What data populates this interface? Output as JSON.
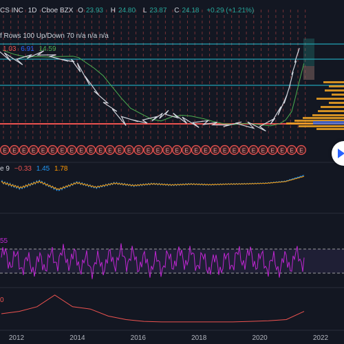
{
  "header": {
    "symbol_partial": "CS INC",
    "interval": "1D",
    "exchange": "Cboe BZX",
    "open_label": "O",
    "open": "23.93",
    "high_label": "H",
    "high": "24.80",
    "low_label": "L",
    "low": "23.87",
    "close_label": "C",
    "close": "24.18",
    "change": "+0.29 (+1.21%)"
  },
  "volume_profile_legend": "f Rows 100 Up/Down 70  n/a  n/a  n/a",
  "ma_legend": {
    "v1": "1.03",
    "v2": "6.91",
    "v3": "14.59"
  },
  "macd_legend": {
    "label": "e 9",
    "v1": "−0.33",
    "v2": "1.45",
    "v3": "1.78"
  },
  "rsi_legend": "55",
  "bottom_legend": "0",
  "scroll_button": {
    "icon": "chevron-right-icon"
  },
  "earnings_marker": {
    "letter": "E",
    "count": 32
  },
  "colors": {
    "background": "#131722",
    "up": "#26a69a",
    "down": "#ef5350",
    "ma_long": "#4caf50",
    "volume_profile": "#f5a623",
    "rsi": "#9c27b0",
    "cyan_line": "#26c6da"
  },
  "chart_data": {
    "type": "line",
    "x_axis_ticks": [
      "2012",
      "2014",
      "2016",
      "2018",
      "2020",
      "2022"
    ],
    "price_series": {
      "name": "Close",
      "x": [
        2011.4,
        2011.8,
        2012.2,
        2012.5,
        2012.9,
        2013.3,
        2013.7,
        2013.9,
        2014.1,
        2014.4,
        2014.7,
        2015.0,
        2015.3,
        2015.6,
        2016.0,
        2016.3,
        2016.6,
        2016.8,
        2017.0,
        2017.3,
        2017.6,
        2018.0,
        2018.3,
        2018.6,
        2019.0,
        2019.4,
        2019.8,
        2020.2,
        2020.5,
        2020.7,
        2020.9,
        2021.0,
        2021.1,
        2021.2,
        2021.3
      ],
      "values": [
        23,
        19,
        17.5,
        21,
        22,
        20,
        18,
        18.5,
        15,
        11,
        8.5,
        7,
        6,
        4.6,
        5.1,
        4.8,
        5.3,
        5.6,
        6.1,
        5.4,
        4.9,
        4.4,
        4.9,
        4.6,
        4.4,
        4.9,
        4.4,
        4.1,
        5.2,
        6.5,
        8.5,
        11,
        15,
        19,
        24.18
      ]
    },
    "macd_series": {
      "values": [
        0.4,
        -0.6,
        0.5,
        -0.9,
        0.3,
        -0.5,
        0.2,
        -0.2,
        0.1,
        -0.1,
        0.05,
        -0.05,
        0.05,
        0.1,
        0.2,
        0.5,
        1.45
      ]
    },
    "rsi_series": {
      "levels": [
        70,
        30
      ]
    },
    "secondary_series": {
      "values": [
        1.0,
        1.2,
        1.6,
        2.6,
        1.6,
        1.4,
        0.8,
        0.5,
        0.35,
        0.3,
        0.3,
        0.3,
        0.3,
        0.3,
        0.35,
        0.4,
        0.5,
        1.2
      ]
    }
  }
}
